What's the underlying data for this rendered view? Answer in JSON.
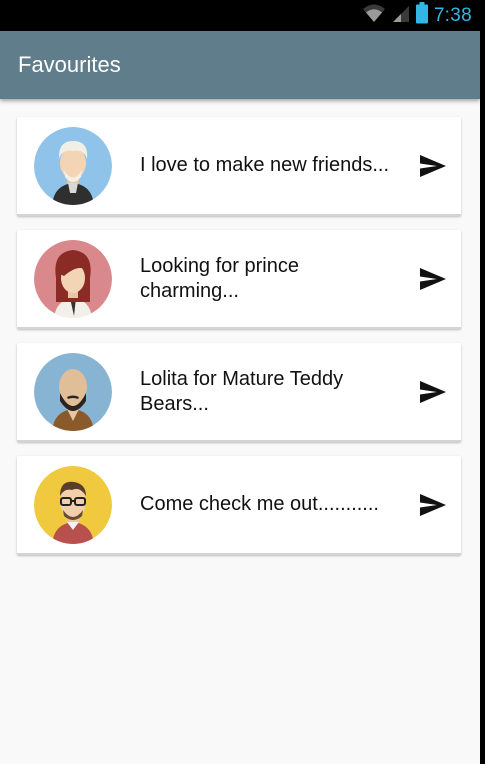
{
  "status_bar": {
    "time": "7:38",
    "wifi_icon": "wifi-icon",
    "signal_icon": "signal-icon",
    "battery_icon": "battery-icon",
    "accent": "#33b5e5"
  },
  "app_bar": {
    "title": "Favourites",
    "color": "#607d8b"
  },
  "favourites": [
    {
      "message": "I love to make new friends...",
      "avatar_bg": "#8fc3ea",
      "avatar_icon": "blond-man-avatar-icon",
      "action_icon": "send-icon"
    },
    {
      "message": "Looking for prince charming...",
      "avatar_bg": "#d9888c",
      "avatar_icon": "red-haired-woman-avatar-icon",
      "action_icon": "send-icon"
    },
    {
      "message": "Lolita for Mature Teddy Bears...",
      "avatar_bg": "#88b4d4",
      "avatar_icon": "bearded-bald-man-avatar-icon",
      "action_icon": "send-icon"
    },
    {
      "message": "Come check me out...........",
      "avatar_bg": "#f0c93e",
      "avatar_icon": "glasses-man-avatar-icon",
      "action_icon": "send-icon"
    }
  ]
}
